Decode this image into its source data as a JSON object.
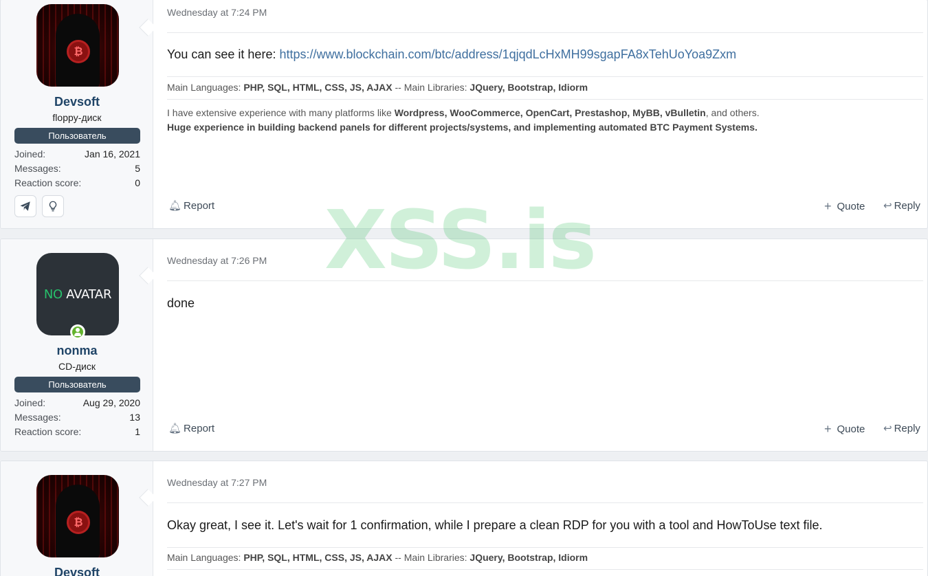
{
  "posts": [
    {
      "user": {
        "name": "Devsoft",
        "title": "floppy-диск",
        "banner": "Пользователь",
        "avatar": "hooded-hacker-bitcoin"
      },
      "stats": {
        "joined_label": "Joined:",
        "joined": "Jan 16, 2021",
        "messages_label": "Messages:",
        "messages": "5",
        "reaction_label": "Reaction score:",
        "reaction": "0"
      },
      "contacts": [
        "telegram-icon",
        "lightbulb-icon"
      ],
      "date": "Wednesday at 7:24 PM",
      "body_prefix": "You can see it here: ",
      "body_link": "https://www.blockchain.com/btc/address/1qjqdLcHxMH99sgapFA8xTehUoYoa9Zxm",
      "sig1": {
        "a": "Main Languages: ",
        "b": "PHP, SQL, HTML, CSS, JS, AJAX",
        "c": " -- Main Libraries: ",
        "d": "JQuery, Bootstrap, Idiorm"
      },
      "sig2": {
        "a": "I have extensive experience with many platforms like ",
        "b": "Wordpress, WooCommerce, OpenCart, Prestashop, MyBB, vBulletin",
        "c": ", and others."
      },
      "sig3": "Huge experience in building backend panels for different projects/systems, and implementing automated BTC Payment Systems.",
      "actions": {
        "report": "Report",
        "quote": "Quote",
        "reply": "Reply"
      }
    },
    {
      "user": {
        "name": "nonma",
        "title": "CD-диск",
        "banner": "Пользователь",
        "avatar_no": "NO",
        "avatar_text": " AVATAR"
      },
      "stats": {
        "joined_label": "Joined:",
        "joined": "Aug 29, 2020",
        "messages_label": "Messages:",
        "messages": "13",
        "reaction_label": "Reaction score:",
        "reaction": "1"
      },
      "date": "Wednesday at 7:26 PM",
      "body": "done",
      "actions": {
        "report": "Report",
        "quote": "Quote",
        "reply": "Reply"
      }
    },
    {
      "user": {
        "name": "Devsoft",
        "avatar": "hooded-hacker-bitcoin"
      },
      "date": "Wednesday at 7:27 PM",
      "body": "Okay great, I see it. Let's wait for 1 confirmation, while I prepare a clean RDP for you with a tool and HowToUse text file.",
      "sig1": {
        "a": "Main Languages: ",
        "b": "PHP, SQL, HTML, CSS, JS, AJAX",
        "c": " -- Main Libraries: ",
        "d": "JQuery, Bootstrap, Idiorm"
      }
    }
  ],
  "watermark": "XSS.is",
  "colors": {
    "username": "#1f4467",
    "banner": "#394c5e",
    "link": "#3f6f9f",
    "online": "#63b32e"
  }
}
